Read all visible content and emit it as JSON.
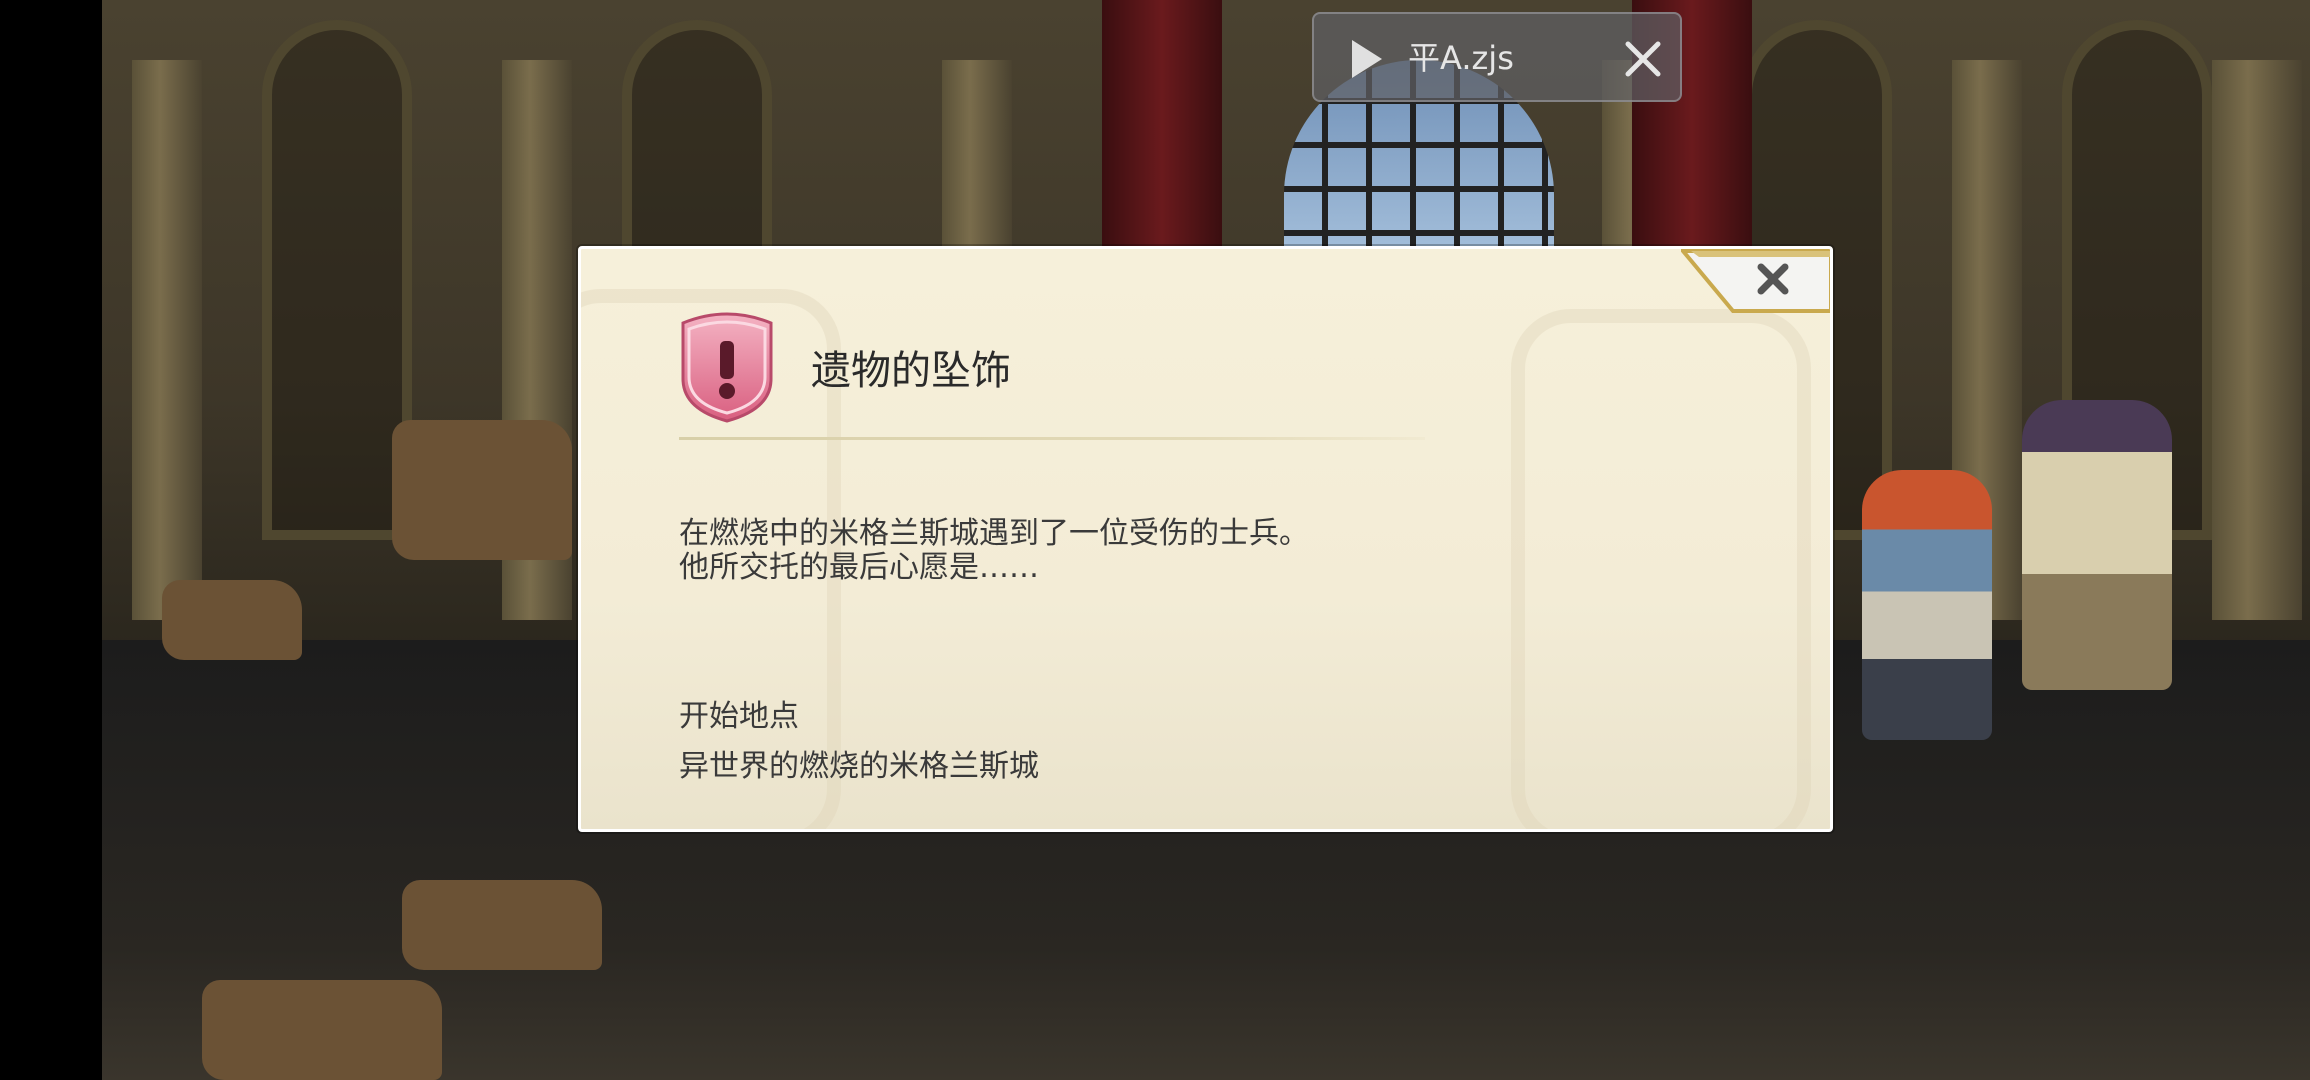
{
  "overlay": {
    "script_name": "平A.zjs",
    "play_icon": "play-icon",
    "close_icon": "close-icon"
  },
  "dialog": {
    "title": "遗物的坠饰",
    "icon": "quest-alert-icon",
    "description_lines": [
      "在燃烧中的米格兰斯城遇到了一位受伤的士兵。",
      "他所交托的最后心愿是……"
    ],
    "start_location_label": "开始地点",
    "start_location_value": "异世界的燃烧的米格兰斯城",
    "close_icon": "close-icon"
  },
  "colors": {
    "dialog_bg": "#f6f0da",
    "icon_pink": "#e8849e",
    "close_gold": "#c9a94e"
  }
}
